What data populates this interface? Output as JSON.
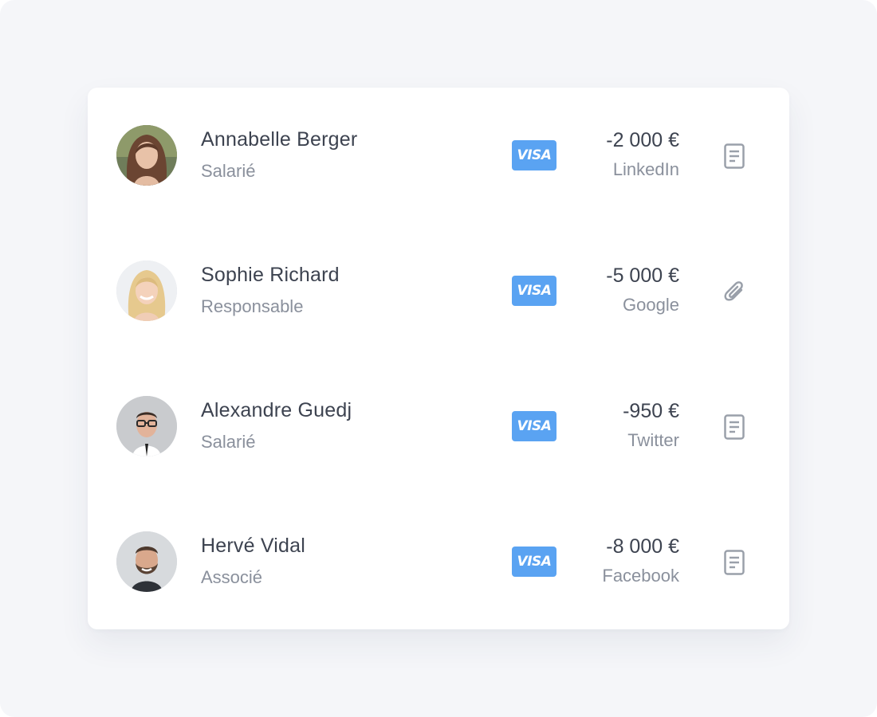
{
  "transactions": [
    {
      "name": "Annabelle Berger",
      "role": "Salarié",
      "card_brand": "VISA",
      "amount": "-2 000 €",
      "source": "LinkedIn",
      "action_icon": "document-icon"
    },
    {
      "name": "Sophie Richard",
      "role": "Responsable",
      "card_brand": "VISA",
      "amount": "-5 000 €",
      "source": "Google",
      "action_icon": "paperclip-icon"
    },
    {
      "name": "Alexandre Guedj",
      "role": "Salarié",
      "card_brand": "VISA",
      "amount": "-950 €",
      "source": "Twitter",
      "action_icon": "document-icon"
    },
    {
      "name": "Hervé Vidal",
      "role": "Associé",
      "card_brand": "VISA",
      "amount": "-8 000 €",
      "source": "Facebook",
      "action_icon": "document-icon"
    }
  ],
  "colors": {
    "page_background": "#f5f6f9",
    "card_background": "#ffffff",
    "visa_blue": "#5aa3f2",
    "primary_text": "#3d4350",
    "secondary_text": "#8a909c",
    "icon_gray": "#9aa0aa"
  }
}
